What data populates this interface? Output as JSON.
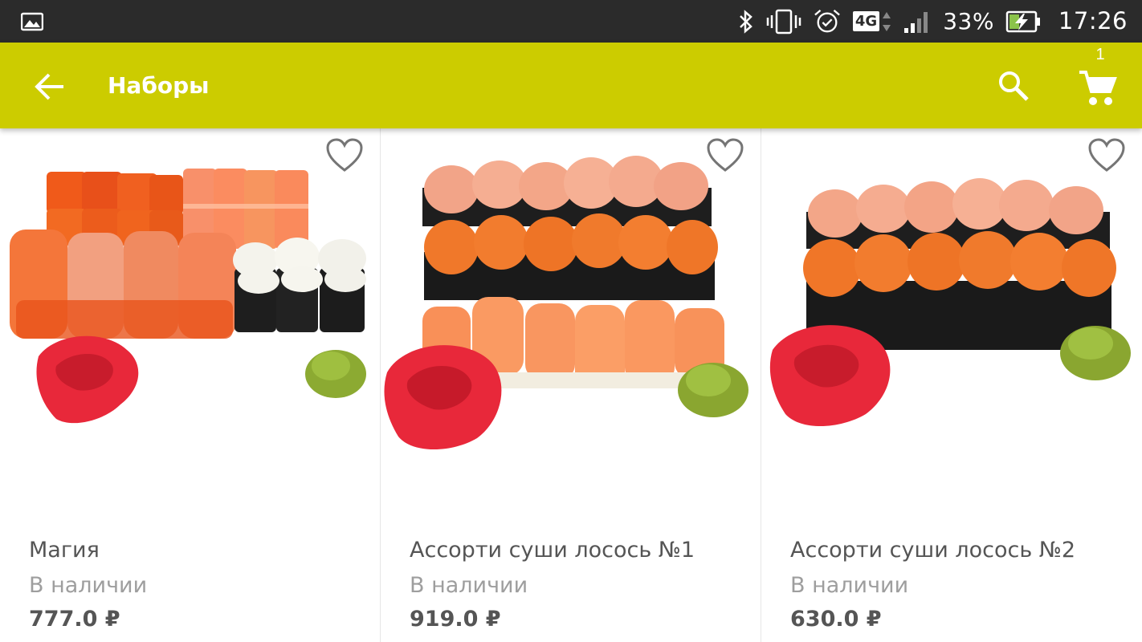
{
  "status_bar": {
    "battery": "33%",
    "network": "4G",
    "time": "17:26",
    "icons": [
      "image-icon",
      "bluetooth-icon",
      "vibrate-icon",
      "alarm-icon",
      "network-4g-icon",
      "signal-icon",
      "battery-charging-icon"
    ]
  },
  "app_bar": {
    "title": "Наборы",
    "cart_count": "1",
    "background_color": "#cccc00",
    "icons": [
      "back-arrow-icon",
      "search-icon",
      "cart-icon"
    ]
  },
  "products": [
    {
      "name": "Магия",
      "stock": "В наличии",
      "price": "777.0 ₽"
    },
    {
      "name": "Ассорти суши лосось №1",
      "stock": "В наличии",
      "price": "919.0 ₽"
    },
    {
      "name": "Ассорти суши лосось №2",
      "stock": "В наличии",
      "price": "630.0 ₽"
    }
  ]
}
